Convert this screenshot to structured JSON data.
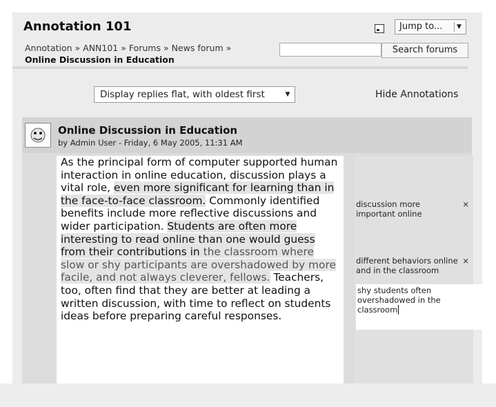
{
  "header": {
    "title": "Annotation 101",
    "jump_label": "Jump to...",
    "breadcrumb_line1": "Annotation » ANN101 » Forums » News forum »",
    "breadcrumb_line2": "Online Discussion in Education",
    "search_button": "Search forums",
    "search_value": ""
  },
  "controls": {
    "display_mode": "Display replies flat, with oldest first",
    "hide_annotations": "Hide Annotations"
  },
  "post": {
    "title": "Online Discussion in Education",
    "by_prefix": "by",
    "author": "Admin User",
    "date": " - Friday, 6 May 2005, 11:31 AM",
    "body": {
      "p1": "As the principal form of computer supported human interaction in online  education, discussion plays a vital role, ",
      "h1": "even more significant for learning  than in the face-to-face classroom.",
      "p2": " Commonly identified benefits include  more reflective discussions and wider participation. ",
      "h2": "Students are often more  interesting to read online than one would guess from their contributions in ",
      "h3": " the classroom where slow or shy participants are overshadowed by more  facile, and not always cleverer, fellows.",
      "p3": " Teachers, too, often find that  they are better at leading a written discussion, with time to reflect on  students ideas before preparing careful responses."
    }
  },
  "annotations": [
    {
      "text": "discussion more important online",
      "close": "×"
    },
    {
      "text": "different behaviors online and in the classroom",
      "close": "×"
    }
  ],
  "annotation_edit": {
    "text": "shy students often overshadowed in the classroom"
  }
}
